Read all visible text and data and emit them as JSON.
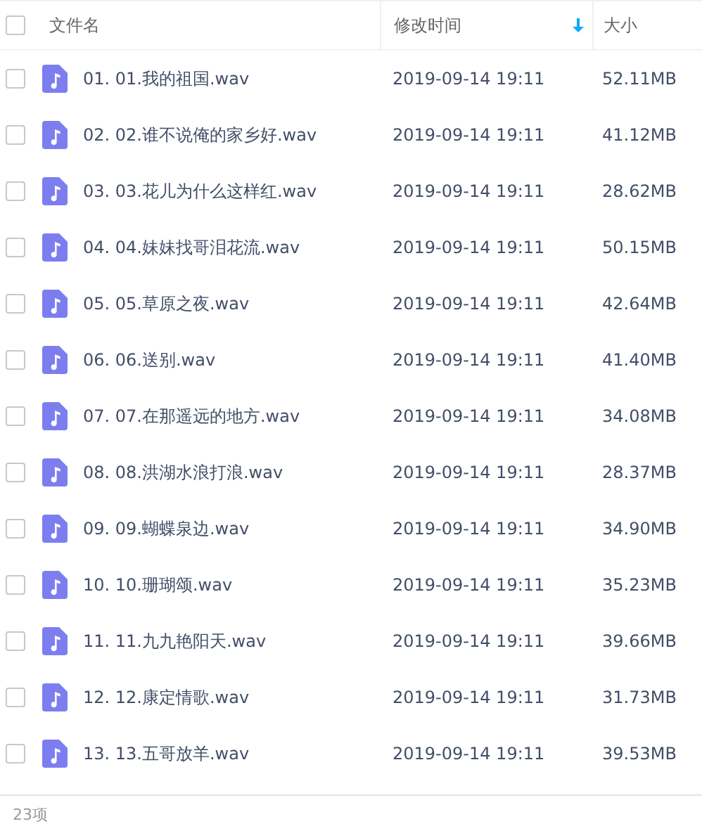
{
  "table": {
    "select_all": {
      "checked": false
    },
    "columns": [
      {
        "label": "文件名"
      },
      {
        "label": "修改时间",
        "sorted": true
      },
      {
        "label": "大小"
      }
    ],
    "rows": [
      {
        "checked": false,
        "name": "01. 01.我的祖国.wav",
        "modified": "2019-09-14 19:11",
        "size": "52.11MB"
      },
      {
        "checked": false,
        "name": "02. 02.谁不说俺的家乡好.wav",
        "modified": "2019-09-14 19:11",
        "size": "41.12MB"
      },
      {
        "checked": false,
        "name": "03. 03.花儿为什么这样红.wav",
        "modified": "2019-09-14 19:11",
        "size": "28.62MB"
      },
      {
        "checked": false,
        "name": "04. 04.妹妹找哥泪花流.wav",
        "modified": "2019-09-14 19:11",
        "size": "50.15MB"
      },
      {
        "checked": false,
        "name": "05. 05.草原之夜.wav",
        "modified": "2019-09-14 19:11",
        "size": "42.64MB"
      },
      {
        "checked": false,
        "name": "06. 06.送别.wav",
        "modified": "2019-09-14 19:11",
        "size": "41.40MB"
      },
      {
        "checked": false,
        "name": "07. 07.在那遥远的地方.wav",
        "modified": "2019-09-14 19:11",
        "size": "34.08MB"
      },
      {
        "checked": false,
        "name": "08. 08.洪湖水浪打浪.wav",
        "modified": "2019-09-14 19:11",
        "size": "28.37MB"
      },
      {
        "checked": false,
        "name": "09. 09.蝴蝶泉边.wav",
        "modified": "2019-09-14 19:11",
        "size": "34.90MB"
      },
      {
        "checked": false,
        "name": "10. 10.珊瑚颂.wav",
        "modified": "2019-09-14 19:11",
        "size": "35.23MB"
      },
      {
        "checked": false,
        "name": "11. 11.九九艳阳天.wav",
        "modified": "2019-09-14 19:11",
        "size": "39.66MB"
      },
      {
        "checked": false,
        "name": "12. 12.康定情歌.wav",
        "modified": "2019-09-14 19:11",
        "size": "31.73MB"
      },
      {
        "checked": false,
        "name": "13. 13.五哥放羊.wav",
        "modified": "2019-09-14 19:11",
        "size": "39.53MB"
      }
    ]
  },
  "status_bar": {
    "count": "23项"
  }
}
